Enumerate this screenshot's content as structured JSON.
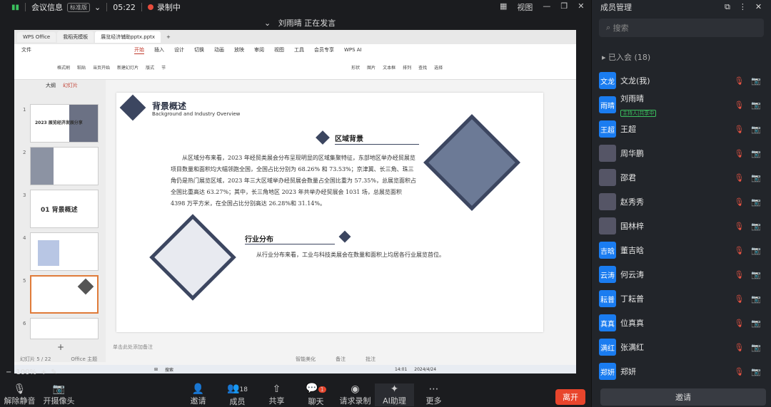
{
  "meeting": {
    "title": "会议信息",
    "badge": "标准版",
    "time": "05:22",
    "recording": "录制中",
    "speaking": "刘雨晴 正在发言",
    "view": "视图"
  },
  "panel": {
    "title": "成员管理",
    "search": "搜索",
    "group": "已入会 (18)",
    "invite": "邀请"
  },
  "members": [
    {
      "avatar": "文龙",
      "name": "文龙(我)",
      "role": ""
    },
    {
      "avatar": "雨晴",
      "name": "刘雨晴",
      "role": "主持人|共享中"
    },
    {
      "avatar": "王超",
      "name": "王超",
      "role": ""
    },
    {
      "avatar": "",
      "name": "周华鹏",
      "role": ""
    },
    {
      "avatar": "",
      "name": "邵君",
      "role": ""
    },
    {
      "avatar": "",
      "name": "赵秀秀",
      "role": ""
    },
    {
      "avatar": "",
      "name": "国林梓",
      "role": ""
    },
    {
      "avatar": "吉晗",
      "name": "董吉晗",
      "role": ""
    },
    {
      "avatar": "云涛",
      "name": "何云涛",
      "role": ""
    },
    {
      "avatar": "耘普",
      "name": "丁耘普",
      "role": ""
    },
    {
      "avatar": "真真",
      "name": "位真真",
      "role": ""
    },
    {
      "avatar": "满红",
      "name": "张满红",
      "role": ""
    },
    {
      "avatar": "郑妍",
      "name": "郑妍",
      "role": ""
    }
  ],
  "wps": {
    "tabs": [
      "WPS Office",
      "我稻壳模板",
      "展览经济辅助pptx.pptx"
    ],
    "menus": [
      "文件",
      "开始",
      "插入",
      "设计",
      "切换",
      "动画",
      "放映",
      "审阅",
      "视图",
      "工具",
      "会员专享",
      "WPS AI"
    ],
    "active_menu": "开始",
    "ribbon": [
      "格式刷",
      "粘贴",
      "当页开始",
      "新建幻灯片",
      "版式",
      "节",
      "形状",
      "图片",
      "文本框",
      "排列",
      "查找",
      "选择"
    ],
    "left_tabs": [
      "大纲",
      "幻灯片"
    ],
    "thumbs": [
      {
        "n": "1",
        "text": "2023 展览经济发展分享"
      },
      {
        "n": "2",
        "text": ""
      },
      {
        "n": "3",
        "text": "01 背景概述"
      },
      {
        "n": "4",
        "text": ""
      },
      {
        "n": "5",
        "text": ""
      },
      {
        "n": "6",
        "text": ""
      }
    ],
    "status": [
      "幻灯片 5 / 22",
      "Office 主题",
      "智能美化",
      "备注",
      "批注"
    ],
    "note_hint": "单击此处添加备注",
    "search": "搜索",
    "clock": "14:01",
    "date": "2024/4/24"
  },
  "slide": {
    "title": "背景概述",
    "subtitle": "Background and Industry Overview",
    "sec1": "区域背景",
    "para1": "从区域分布来看，2023 年经贸类展会分布呈现明显的区域集聚特征，东部地区举办经贸展览项目数量和面积均大幅领跑全国，全国占比分别为 68.26% 和 73.53%；京津冀、长三角、珠三角仍是热门展览区域，2023 年三大区域举办经贸展会数量占全国比重为 57.35%，总展览面积占全国比重高达 63.27%；其中，长三角地区 2023 年共举办经贸展会 1031 场，总展览面积 4398 万平方米，在全国占比分别高达 26.28%和 31.14%。",
    "sec2": "行业分布",
    "para2": "从行业分布来看，工业与科技类展会在数量和面积上均居各行业展览首位。"
  },
  "zoom": "100%",
  "toolbar": [
    "解除静音",
    "开摄像头",
    "邀请",
    "成员",
    "共享",
    "聊天",
    "请求录制",
    "AI助理",
    "更多"
  ],
  "member_count": "18",
  "chat_badge": "1",
  "leave": "离开"
}
